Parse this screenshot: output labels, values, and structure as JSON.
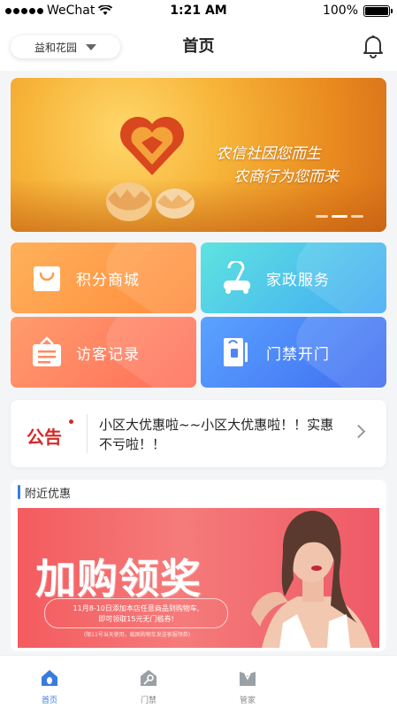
{
  "status": {
    "carrier": "WeChat",
    "time": "1:21 AM",
    "battery": "100%"
  },
  "header": {
    "location": "益和花园",
    "title": "首页"
  },
  "banner": {
    "line1": "农信社因您而生",
    "line2": "农商行为您而来"
  },
  "tiles": [
    {
      "label": "积分商城",
      "icon": "shopping-bag-icon"
    },
    {
      "label": "家政服务",
      "icon": "vacuum-cleaner-icon"
    },
    {
      "label": "访客记录",
      "icon": "visitor-sign-icon"
    },
    {
      "label": "门禁开门",
      "icon": "door-access-icon"
    }
  ],
  "notice": {
    "badge": "公告",
    "text": "小区大优惠啦~~小区大优惠啦！！实惠不亏啦！！"
  },
  "nearby": {
    "title": "附近优惠",
    "promo": {
      "headline": "加购领奖",
      "line1": "11月8-10日添加本店任意商品到购物车,",
      "line2": "即可领取15元无门槛券!",
      "note": "(限11号当天使用，截图购物车发送客服领券)"
    }
  },
  "tabbar": [
    {
      "label": "首页",
      "icon": "home-icon",
      "active": true
    },
    {
      "label": "门禁",
      "icon": "key-house-icon",
      "active": false
    },
    {
      "label": "管家",
      "icon": "butler-icon",
      "active": false
    }
  ],
  "colors": {
    "accent": "#3a7be0",
    "notice_red": "#d42a2a"
  }
}
